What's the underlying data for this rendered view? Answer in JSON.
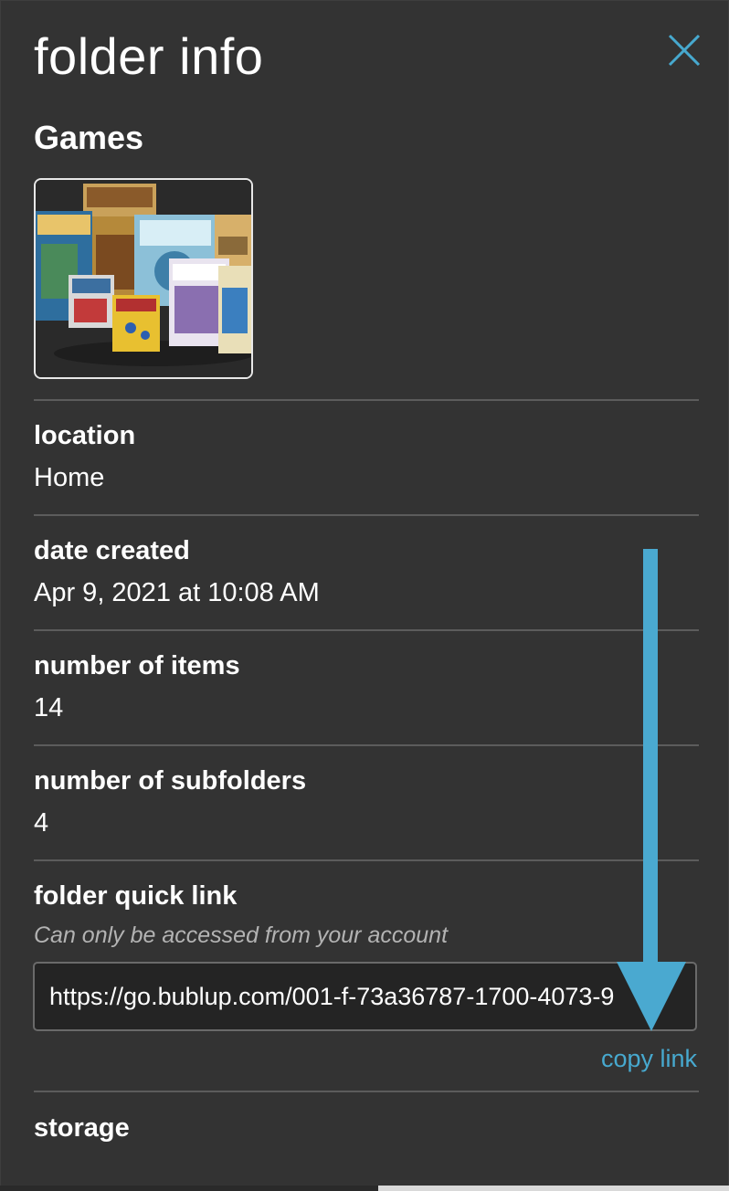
{
  "header": {
    "title": "folder info",
    "close_icon": "close-icon"
  },
  "folder": {
    "name": "Games",
    "thumbnail_icon": "board-games-thumbnail"
  },
  "fields": {
    "location": {
      "label": "location",
      "value": "Home"
    },
    "date_created": {
      "label": "date created",
      "value": "Apr 9, 2021 at 10:08 AM"
    },
    "items": {
      "label": "number of items",
      "value": "14"
    },
    "subfolders": {
      "label": "number of subfolders",
      "value": "4"
    },
    "quick_link": {
      "label": "folder quick link",
      "note": "Can only be accessed from your account",
      "url": "https://go.bublup.com/001-f-73a36787-1700-4073-9",
      "copy_label": "copy link"
    },
    "storage": {
      "label": "storage"
    }
  },
  "colors": {
    "panel_bg": "#333333",
    "accent": "#47a9cf",
    "annotation_arrow": "#4aa9d0"
  }
}
